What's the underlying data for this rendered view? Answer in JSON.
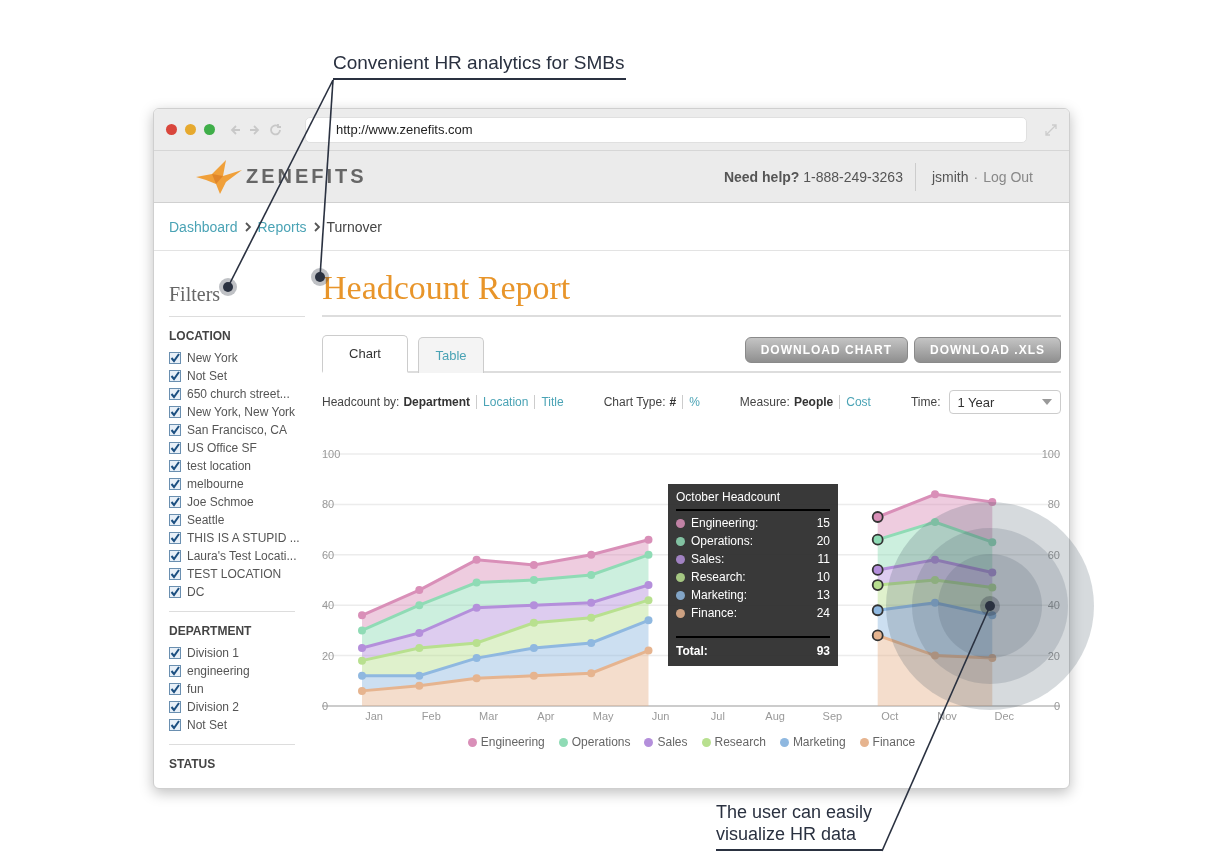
{
  "annotations": [
    {
      "text": "Convenient HR analytics for SMBs"
    },
    {
      "text": "The user can easily visualize HR data"
    }
  ],
  "window": {
    "url": "http://www.zenefits.com"
  },
  "header": {
    "logo_text": "ZENEFITS",
    "help": "**Need help?** 1-888-249-3263",
    "user": "jsmith",
    "separator": "·",
    "logout": "Log Out"
  },
  "breadcrumb": [
    "Dashboard",
    "Reports",
    "Turnover"
  ],
  "sidebar": {
    "title": "Filters",
    "groups": [
      {
        "heading": "LOCATION",
        "items": [
          {
            "label": "New York",
            "checked": true
          },
          {
            "label": "Not Set",
            "checked": true
          },
          {
            "label": "650 church street...",
            "checked": true
          },
          {
            "label": "New York, New York",
            "checked": true
          },
          {
            "label": "San Francisco, CA",
            "checked": true
          },
          {
            "label": "US Office SF",
            "checked": true
          },
          {
            "label": "test location",
            "checked": true
          },
          {
            "label": "melbourne",
            "checked": true
          },
          {
            "label": "Joe Schmoe",
            "checked": true
          },
          {
            "label": "Seattle",
            "checked": true
          },
          {
            "label": "THIS IS A STUPID ...",
            "checked": true
          },
          {
            "label": "Laura's Test Locati...",
            "checked": true
          },
          {
            "label": "TEST LOCATION",
            "checked": true
          },
          {
            "label": "DC",
            "checked": true
          }
        ]
      },
      {
        "heading": "DEPARTMENT",
        "items": [
          {
            "label": "Division 1",
            "checked": true
          },
          {
            "label": "engineering",
            "checked": true
          },
          {
            "label": "fun",
            "checked": true
          },
          {
            "label": "Division 2",
            "checked": true
          },
          {
            "label": "Not Set",
            "checked": true
          }
        ]
      },
      {
        "heading": "STATUS"
      }
    ]
  },
  "report": {
    "title": "Headcount Report",
    "tabs": [
      {
        "label": "Chart",
        "selected": true
      },
      {
        "label": "Table",
        "selected": false
      }
    ],
    "buttons": [
      "DOWNLOAD CHART",
      "DOWNLOAD .XLS"
    ],
    "controls": [
      {
        "label": "Headcount by:",
        "options": [
          {
            "label": "Department",
            "selected": true
          },
          {
            "label": "Location",
            "selected": false
          },
          {
            "label": "Title",
            "selected": false
          }
        ]
      },
      {
        "label": "Chart Type:",
        "options": [
          {
            "label": "#",
            "selected": true
          },
          {
            "label": "%",
            "selected": false
          }
        ]
      },
      {
        "label": "Measure:",
        "options": [
          {
            "label": "People",
            "selected": true
          },
          {
            "label": "Cost",
            "selected": false
          }
        ]
      }
    ],
    "time": {
      "label": "Time:",
      "value": "1 Year"
    },
    "chart_data": {
      "type": "area",
      "stacked": true,
      "categories": [
        "Jan",
        "Feb",
        "Mar",
        "Apr",
        "May",
        "Jun",
        "Jul",
        "Aug",
        "Sep",
        "Oct",
        "Nov",
        "Dec"
      ],
      "ylim": [
        0,
        100
      ],
      "yticks": [
        0,
        20,
        40,
        60,
        80,
        100
      ],
      "series": [
        {
          "name": "Engineering",
          "color": "#d98fb8",
          "values": [
            6,
            6,
            9,
            6,
            8,
            6,
            null,
            null,
            null,
            9,
            11,
            16
          ]
        },
        {
          "name": "Operations",
          "color": "#8fdbb5",
          "values": [
            7,
            11,
            10,
            10,
            11,
            12,
            null,
            null,
            null,
            12,
            15,
            12
          ]
        },
        {
          "name": "Sales",
          "color": "#b48fdb",
          "values": [
            5,
            6,
            14,
            7,
            6,
            6,
            null,
            null,
            null,
            6,
            8,
            6
          ]
        },
        {
          "name": "Research",
          "color": "#b8e08f",
          "values": [
            6,
            11,
            6,
            10,
            10,
            8,
            null,
            null,
            null,
            10,
            9,
            11
          ]
        },
        {
          "name": "Marketing",
          "color": "#8fb8e0",
          "values": [
            6,
            4,
            8,
            11,
            12,
            12,
            null,
            null,
            null,
            10,
            21,
            17
          ]
        },
        {
          "name": "Finance",
          "color": "#e6b48f",
          "values": [
            6,
            8,
            11,
            12,
            13,
            22,
            null,
            null,
            null,
            28,
            20,
            19
          ]
        }
      ],
      "grid": true,
      "annotations": [
        {
          "x": "Oct"
        }
      ]
    },
    "right_axis_labels": [
      "100",
      "80",
      "60",
      "40",
      "20",
      "0"
    ],
    "tooltip": {
      "title": "October Headcount",
      "items": [
        {
          "label": "Engineering:",
          "value": "15"
        },
        {
          "label": "Operations:",
          "value": "20"
        },
        {
          "label": "Sales:",
          "value": "11"
        },
        {
          "label": "Research:",
          "value": "10"
        },
        {
          "label": "Marketing:",
          "value": "13"
        },
        {
          "label": "Finance:",
          "value": "24"
        }
      ],
      "total_label": "Total:",
      "total": "93"
    }
  }
}
